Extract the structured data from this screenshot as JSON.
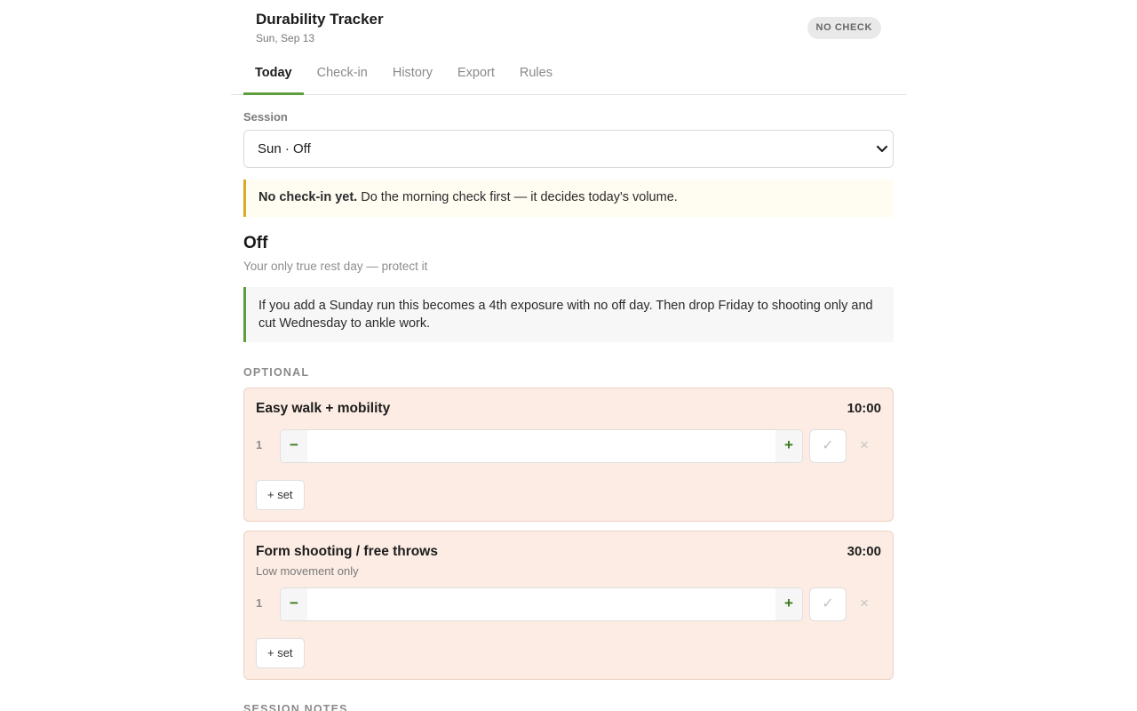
{
  "header": {
    "title": "Durability Tracker",
    "date": "Sun, Sep 13",
    "badge": "NO CHECK"
  },
  "tabs": [
    {
      "label": "Today",
      "active": true
    },
    {
      "label": "Check-in",
      "active": false
    },
    {
      "label": "History",
      "active": false
    },
    {
      "label": "Export",
      "active": false
    },
    {
      "label": "Rules",
      "active": false
    }
  ],
  "session": {
    "label": "Session",
    "selected": "Sun · Off"
  },
  "warning": {
    "bold": "No check-in yet.",
    "text": " Do the morning check first — it decides today's volume."
  },
  "day": {
    "title": "Off",
    "subtitle": "Your only true rest day — protect it",
    "note": "If you add a Sunday run this becomes a 4th exposure with no off day. Then drop Friday to shooting only and cut Wednesday to ankle work."
  },
  "optional": {
    "title": "OPTIONAL",
    "cards": [
      {
        "title": "Easy walk + mobility",
        "time": "10:00",
        "subtitle": "",
        "sets": [
          {
            "num": "1",
            "value": ""
          }
        ],
        "add_label": "+ set"
      },
      {
        "title": "Form shooting / free throws",
        "time": "30:00",
        "subtitle": "Low movement only",
        "sets": [
          {
            "num": "1",
            "value": ""
          }
        ],
        "add_label": "+ set"
      }
    ]
  },
  "controls": {
    "minus": "−",
    "plus": "+",
    "check": "✓",
    "remove": "×"
  },
  "notes": {
    "title": "SESSION NOTES"
  },
  "colors": {
    "accent_green": "#5f9e3d",
    "warning_yellow": "#d9a825",
    "card_bg": "#fcece3"
  }
}
